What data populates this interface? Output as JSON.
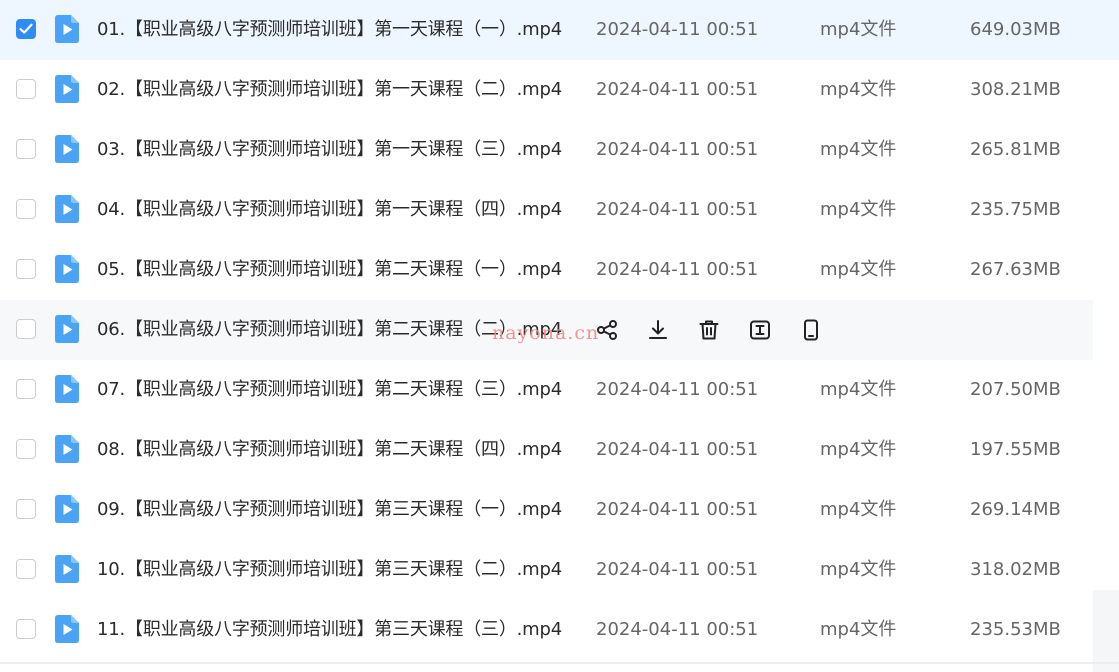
{
  "colors": {
    "accent": "#2e8cf5",
    "selected_row_bg": "#eef6ff",
    "hover_row_bg": "#f7f8fa",
    "file_icon": "#4aa3f4",
    "watermark": "#f08a8a"
  },
  "files": [
    {
      "name": "01.【职业高级八字预测师培训班】第一天课程（一）.mp4",
      "date": "2024-04-11 00:51",
      "type": "mp4文件",
      "size": "649.03MB",
      "checked": true
    },
    {
      "name": "02.【职业高级八字预测师培训班】第一天课程（二）.mp4",
      "date": "2024-04-11 00:51",
      "type": "mp4文件",
      "size": "308.21MB",
      "checked": false
    },
    {
      "name": "03.【职业高级八字预测师培训班】第一天课程（三）.mp4",
      "date": "2024-04-11 00:51",
      "type": "mp4文件",
      "size": "265.81MB",
      "checked": false
    },
    {
      "name": "04.【职业高级八字预测师培训班】第一天课程（四）.mp4",
      "date": "2024-04-11 00:51",
      "type": "mp4文件",
      "size": "235.75MB",
      "checked": false
    },
    {
      "name": "05.【职业高级八字预测师培训班】第二天课程（一）.mp4",
      "date": "2024-04-11 00:51",
      "type": "mp4文件",
      "size": "267.63MB",
      "checked": false
    },
    {
      "name": "06.【职业高级八字预测师培训班】第二天课程（二）.mp4",
      "checked": false,
      "hovered": true
    },
    {
      "name": "07.【职业高级八字预测师培训班】第二天课程（三）.mp4",
      "date": "2024-04-11 00:51",
      "type": "mp4文件",
      "size": "207.50MB",
      "checked": false
    },
    {
      "name": "08.【职业高级八字预测师培训班】第二天课程（四）.mp4",
      "date": "2024-04-11 00:51",
      "type": "mp4文件",
      "size": "197.55MB",
      "checked": false
    },
    {
      "name": "09.【职业高级八字预测师培训班】第三天课程（一）.mp4",
      "date": "2024-04-11 00:51",
      "type": "mp4文件",
      "size": "269.14MB",
      "checked": false
    },
    {
      "name": "10.【职业高级八字预测师培训班】第三天课程（二）.mp4",
      "date": "2024-04-11 00:51",
      "type": "mp4文件",
      "size": "318.02MB",
      "checked": false
    },
    {
      "name": "11.【职业高级八字预测师培训班】第三天课程（三）.mp4",
      "date": "2024-04-11 00:51",
      "type": "mp4文件",
      "size": "235.53MB",
      "checked": false
    }
  ],
  "hover_actions": [
    {
      "icon": "share-icon"
    },
    {
      "icon": "download-icon"
    },
    {
      "icon": "trash-icon"
    },
    {
      "icon": "rename-icon"
    },
    {
      "icon": "phone-icon"
    }
  ],
  "watermark": "nayona.cn"
}
